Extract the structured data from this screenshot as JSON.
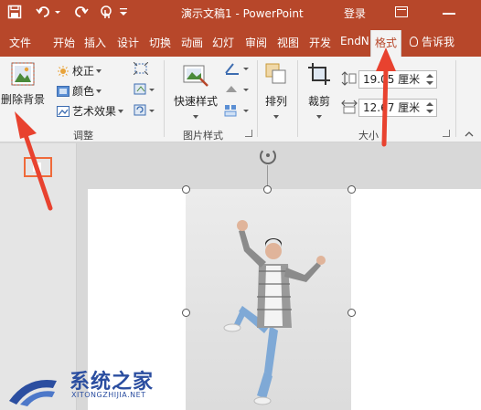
{
  "window": {
    "title": "演示文稿1 - PowerPoint",
    "login_label": "登录"
  },
  "tabs": [
    {
      "label": "文件"
    },
    {
      "label": "开始"
    },
    {
      "label": "插入"
    },
    {
      "label": "设计"
    },
    {
      "label": "切换"
    },
    {
      "label": "动画"
    },
    {
      "label": "幻灯"
    },
    {
      "label": "审阅"
    },
    {
      "label": "视图"
    },
    {
      "label": "开发"
    },
    {
      "label": "EndN"
    },
    {
      "label": "格式",
      "active": true
    }
  ],
  "tell_me": "告诉我",
  "ribbon": {
    "adjust": {
      "remove_bg_label": "删除背景",
      "corrections_label": "校正",
      "color_label": "颜色",
      "artistic_label": "艺术效果",
      "group_label": "调整"
    },
    "picture_styles": {
      "quick_styles_label": "快速样式",
      "group_label": "图片样式"
    },
    "arrange": {
      "arrange_label": "排列"
    },
    "size": {
      "crop_label": "裁剪",
      "height_value": "19.05 厘米",
      "width_value": "12.67 厘米",
      "group_label": "大小"
    }
  },
  "watermark": {
    "text": "系统之家",
    "url": "XITONGZHIJIA.NET"
  },
  "colors": {
    "accent": "#b7472a",
    "annotation": "#e8422f",
    "watermark": "#2b4ea0"
  },
  "icons": [
    "save-icon",
    "undo-icon",
    "redo-icon",
    "touch-mode-icon",
    "ribbon-display-icon",
    "minimize-icon",
    "lightbulb-icon",
    "rotate-handle-icon"
  ]
}
